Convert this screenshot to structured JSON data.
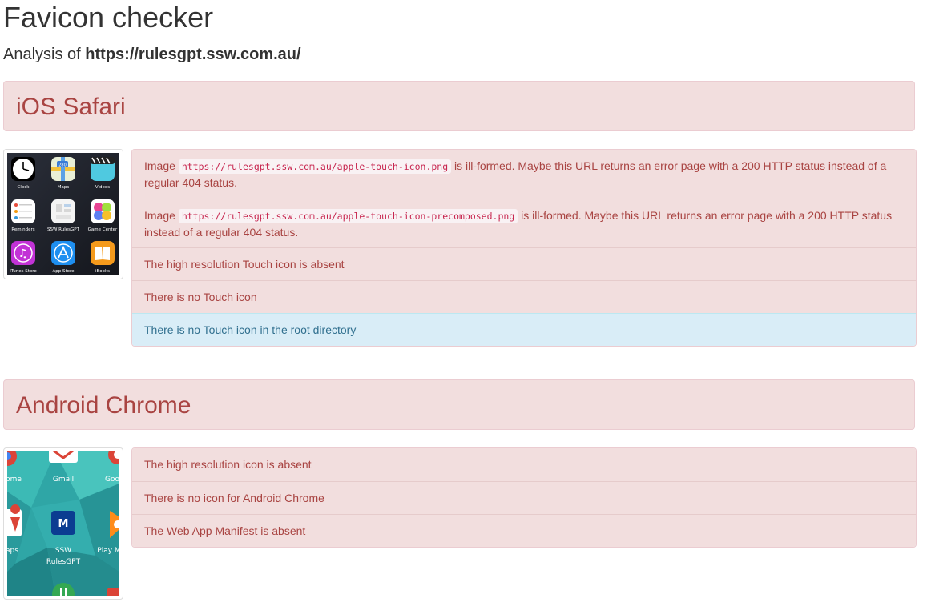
{
  "header": {
    "title": "Favicon checker",
    "analysis_prefix": "Analysis of",
    "analysis_url": "https://rulesgpt.ssw.com.au/"
  },
  "ios": {
    "title": "iOS Safari",
    "screenshot_labels": [
      "Clock",
      "Maps",
      "Videos",
      "Reminders",
      "SSW RulesGPT",
      "Game Center",
      "iTunes Store",
      "App Store",
      "iBooks"
    ],
    "maps_badge": "280",
    "messages": [
      {
        "prefix": "Image",
        "code": "https://rulesgpt.ssw.com.au/apple-touch-icon.png",
        "suffix": "is ill-formed. Maybe this URL returns an error page with a 200 HTTP status instead of a regular 404 status."
      },
      {
        "prefix": "Image",
        "code": "https://rulesgpt.ssw.com.au/apple-touch-icon-precomposed.png",
        "suffix": "is ill-formed. Maybe this URL returns an error page with a 200 HTTP status instead of a regular 404 status."
      },
      {
        "text": "The high resolution Touch icon is absent"
      },
      {
        "text": "There is no Touch icon"
      },
      {
        "text": "There is no Touch icon in the root directory"
      }
    ]
  },
  "android": {
    "title": "Android Chrome",
    "screenshot_labels": [
      "ome",
      "Gmail",
      "Goo",
      "aps",
      "SSW",
      "RulesGPT",
      "Play M"
    ],
    "center_icon_letter": "M",
    "messages": [
      "The high resolution icon is absent",
      "There is no icon for Android Chrome",
      "The Web App Manifest is absent"
    ]
  },
  "colors": {
    "danger_bg": "#f2dede",
    "danger_text": "#a94442",
    "info_bg": "#d9edf7",
    "info_text": "#31708f"
  }
}
